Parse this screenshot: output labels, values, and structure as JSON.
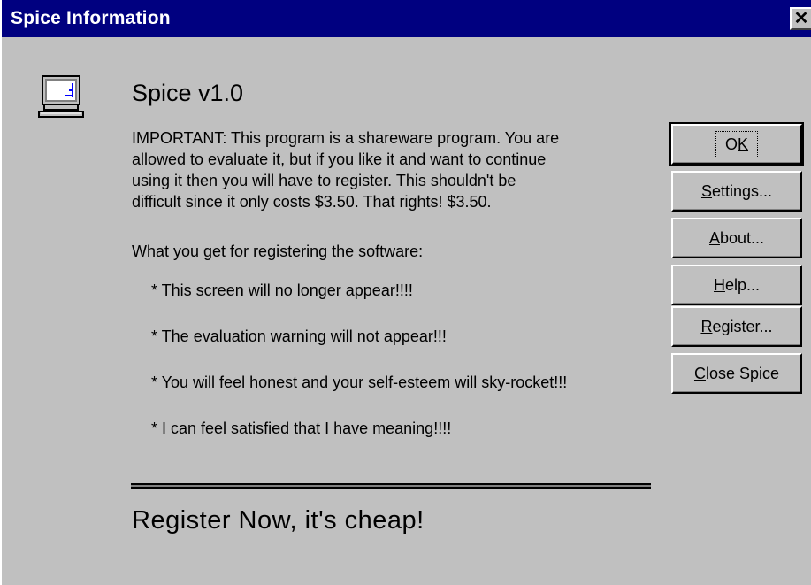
{
  "window": {
    "title": "Spice Information",
    "close_glyph": "✕"
  },
  "icon": {
    "name": "monitor-icon"
  },
  "content": {
    "heading": "Spice v1.0",
    "intro": "IMPORTANT:  This program is a shareware program.  You are\nallowed to evaluate it, but if you like it and want to continue\nusing it then you will have to register.  This shouldn't be\ndifficult since it only costs $3.50.  That rights! $3.50.",
    "benefits_heading": "What you get for registering the software:",
    "bullets": [
      "* This screen will no longer appear!!!!",
      "* The evaluation warning will not appear!!!",
      "* You will feel honest and your self-esteem will sky-rocket!!!",
      "* I can feel satisfied that I have meaning!!!!"
    ],
    "call_to_action": "Register Now, it's cheap!"
  },
  "buttons": {
    "ok": {
      "pre": "O",
      "accel": "K",
      "post": ""
    },
    "settings": {
      "pre": "",
      "accel": "S",
      "post": "ettings..."
    },
    "about": {
      "pre": "",
      "accel": "A",
      "post": "bout..."
    },
    "help": {
      "pre": "",
      "accel": "H",
      "post": "elp..."
    },
    "register": {
      "pre": "",
      "accel": "R",
      "post": "egister..."
    },
    "close": {
      "pre": "",
      "accel": "C",
      "post": "lose Spice"
    }
  },
  "colors": {
    "titlebar": "#000080",
    "face": "#c0c0c0"
  }
}
